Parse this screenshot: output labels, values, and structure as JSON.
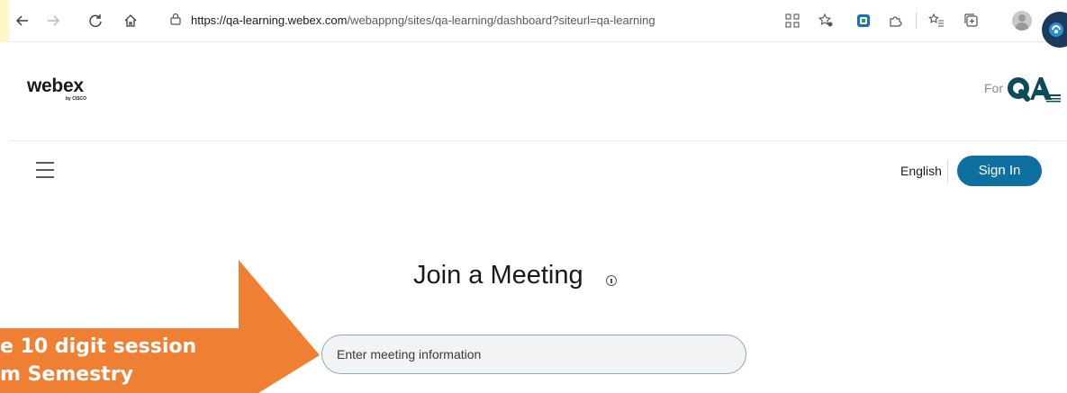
{
  "browser": {
    "url_host": "https://qa-learning.webex.com",
    "url_path": "/webappng/sites/qa-learning/dashboard?siteurl=qa-learning"
  },
  "header": {
    "logo_text": "webex",
    "logo_tagline": "by CISCO",
    "for_label": "For"
  },
  "nav": {
    "language": "English",
    "sign_in": "Sign In"
  },
  "join": {
    "title": "Join a Meeting",
    "input_placeholder": "Enter meeting information"
  },
  "callout": {
    "line1": "e 10 digit session",
    "line2": "m Semestry"
  },
  "colors": {
    "accent": "#0e6fa1",
    "callout": "#ef8033"
  }
}
